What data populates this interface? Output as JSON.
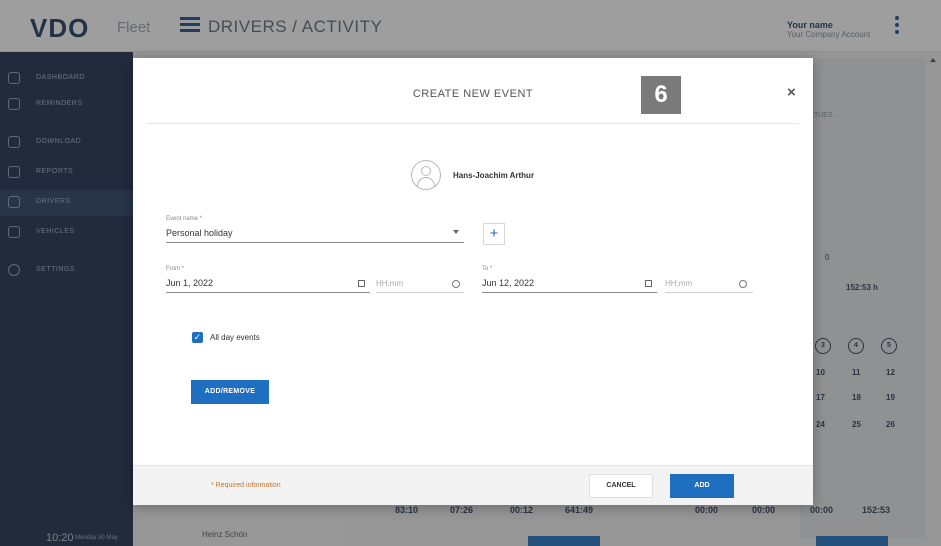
{
  "topbar": {
    "logo": "VDO",
    "logo_suffix": "Fleet",
    "title": "DRIVERS / ACTIVITY",
    "user_name": "Your name",
    "user_account": "Your Company Account"
  },
  "sidebar": {
    "items": [
      {
        "label": "DASHBOARD",
        "icon": "dashboard-icon"
      },
      {
        "label": "REMINDERS",
        "icon": "bell-icon"
      },
      {
        "label": "DOWNLOAD",
        "icon": "download-icon"
      },
      {
        "label": "REPORTS",
        "icon": "report-icon"
      },
      {
        "label": "DRIVERS",
        "icon": "driver-icon"
      },
      {
        "label": "VEHICLES",
        "icon": "vehicle-icon"
      },
      {
        "label": "SETTINGS",
        "icon": "gear-icon"
      }
    ],
    "time": "10:20",
    "date": "Monday 30 May"
  },
  "background": {
    "tab_fragment": "ITUES",
    "count_fragment": "0",
    "total_hours": "152:53 h",
    "week_row_1": [
      "3",
      "4",
      "5"
    ],
    "week_row_2": [
      "10",
      "11",
      "12"
    ],
    "week_row_3": [
      "17",
      "18",
      "19"
    ],
    "week_row_4": [
      "24",
      "25",
      "26"
    ],
    "driver_name": "Heinz Schön",
    "stats_left": [
      "83:10",
      "07:26",
      "00:12",
      "641:49"
    ],
    "stats_right": [
      "00:00",
      "00:00",
      "00:00",
      "152:53"
    ]
  },
  "modal": {
    "title": "CREATE NEW EVENT",
    "step_badge": "6",
    "close_symbol": "×",
    "driver_name": "Hans-Joachim Arthur",
    "event_name_label": "Event name *",
    "event_name_value": "Personal holiday",
    "add_symbol": "+",
    "from_label": "From *",
    "from_date": "Jun 1, 2022",
    "from_time_placeholder": "HH:mm",
    "to_label": "To *",
    "to_date": "Jun 12, 2022",
    "to_time_placeholder": "HH:mm",
    "all_day_label": "All day events",
    "all_day_checked": true,
    "add_remove_label": "ADD/REMOVE",
    "required_note": "* Required information",
    "cancel_label": "CANCEL",
    "add_label": "ADD"
  },
  "colors": {
    "primary": "#1f6fc0",
    "sidebar": "#1c2f4b",
    "required": "#c8742a"
  }
}
